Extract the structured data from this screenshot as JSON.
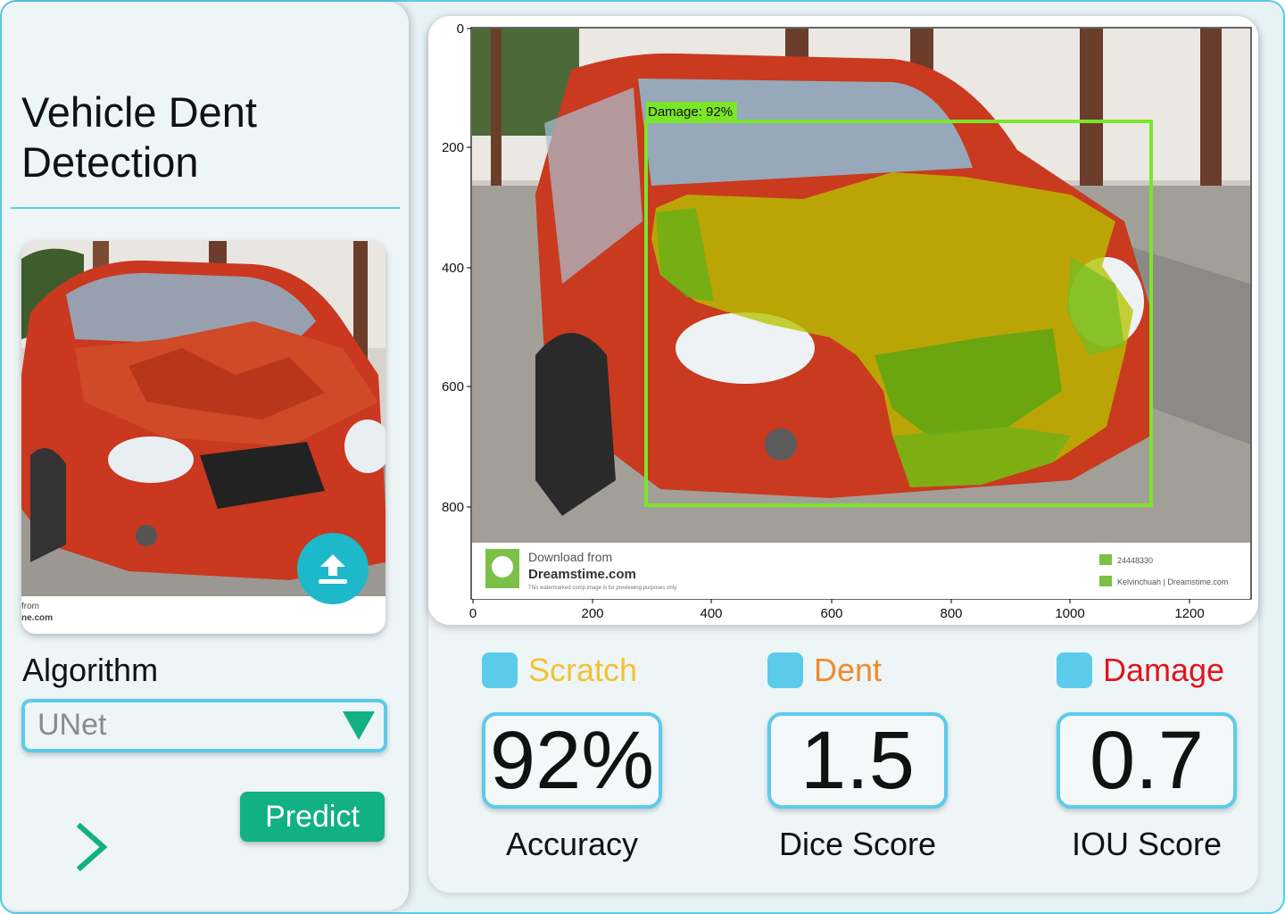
{
  "app": {
    "title": "Vehicle Dent Detection"
  },
  "sidebar": {
    "algorithm_label": "Algorithm",
    "algorithm_value": "UNet",
    "predict_label": "Predict",
    "thumbnail_watermark_lines": [
      "from",
      "ne.com"
    ]
  },
  "plot": {
    "y_ticks": [
      "0",
      "200",
      "400",
      "600",
      "800"
    ],
    "x_ticks": [
      "0",
      "200",
      "400",
      "600",
      "800",
      "1000",
      "1200"
    ],
    "detection_label": "Damage: 92%",
    "watermark": {
      "download_from": "Download from",
      "site": "Dreamstime.com",
      "note": "This watermarked comp image is for previewing purposes only.",
      "id": "24448330",
      "credit": "Kelvinchuah | Dreamstime.com"
    }
  },
  "legend": [
    {
      "label": "Scratch",
      "color": "#f2c233"
    },
    {
      "label": "Dent",
      "color": "#f08a2c"
    },
    {
      "label": "Damage",
      "color": "#e0161b"
    }
  ],
  "metrics": [
    {
      "value": "92%",
      "label": "Accuracy"
    },
    {
      "value": "1.5",
      "label": "Dice Score"
    },
    {
      "value": "0.7",
      "label": "IOU Score"
    }
  ],
  "colors": {
    "accent": "#5ccbea",
    "predict_button": "#12b085",
    "upload_button": "#1db8c9",
    "bbox": "#7be52a",
    "mask": "#c8c800"
  }
}
